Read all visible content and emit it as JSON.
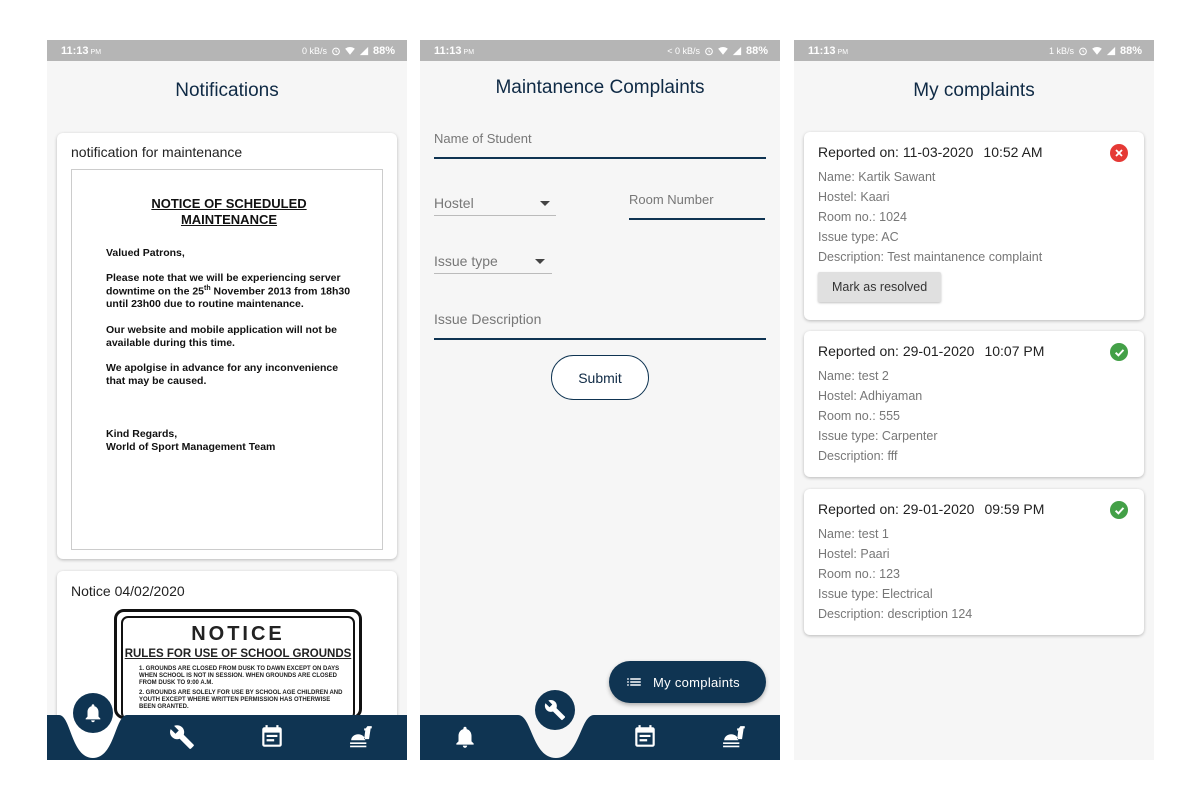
{
  "screens": [
    {
      "status": {
        "time": "11:13",
        "ampm": "PM",
        "speed": "0 kB/s",
        "battery": "88%"
      },
      "title": "Notifications",
      "cards": [
        {
          "title": "notification for maintenance",
          "doc": {
            "heading_line1": "NOTICE OF SCHEDULED",
            "heading_line2": "MAINTENANCE",
            "greeting": "Valued Patrons,",
            "para1_before": "Please note that we will be experiencing server downtime on the 25",
            "para1_sup": "th",
            "para1_after": " November 2013 from 18h30 until 23h00 due to routine maintenance.",
            "para2": "Our website and mobile application will not be available during this time.",
            "para3": "We apolgise in advance for any inconvenience that may be caused.",
            "signoff": "Kind Regards,",
            "team": "World of Sport Management Team"
          }
        },
        {
          "title": "Notice 04/02/2020",
          "sign": {
            "title": "NOTICE",
            "subtitle": "RULES FOR USE OF SCHOOL GROUNDS",
            "rule1": "1.   GROUNDS ARE CLOSED FROM DUSK TO DAWN EXCEPT ON DAYS WHEN SCHOOL IS NOT IN SESSION. WHEN GROUNDS ARE CLOSED FROM DUSK TO 9:00 A.M.",
            "rule2": "2.   GROUNDS ARE SOLELY FOR USE BY SCHOOL AGE CHILDREN AND YOUTH EXCEPT WHERE WRITTEN PERMISSION HAS OTHERWISE BEEN GRANTED."
          }
        }
      ]
    },
    {
      "status": {
        "time": "11:13",
        "ampm": "PM",
        "speed": "< 0 kB/s",
        "battery": "88%"
      },
      "title": "Maintanence Complaints",
      "form": {
        "name_placeholder": "Name of Student",
        "hostel_placeholder": "Hostel",
        "room_placeholder": "Room Number",
        "issue_type_placeholder": "Issue type",
        "description_placeholder": "Issue Description",
        "submit_label": "Submit"
      },
      "fab_label": "My complaints"
    },
    {
      "status": {
        "time": "11:13",
        "ampm": "PM",
        "speed": "1 kB/s",
        "battery": "88%"
      },
      "title": "My complaints",
      "complaints": [
        {
          "date": "Reported on: 11-03-2020",
          "time": "10:52 AM",
          "name": "Name: Kartik Sawant",
          "hostel": "Hostel: Kaari",
          "room": "Room no.: 1024",
          "issue": "Issue type: AC",
          "description": "Description: Test maintanence complaint",
          "status": "unresolved",
          "action": "Mark as resolved"
        },
        {
          "date": "Reported on: 29-01-2020",
          "time": "10:07 PM",
          "name": "Name: test 2",
          "hostel": "Hostel: Adhiyaman",
          "room": "Room no.: 555",
          "issue": "Issue type: Carpenter",
          "description": "Description: fff",
          "status": "resolved"
        },
        {
          "date": "Reported on: 29-01-2020",
          "time": "09:59 PM",
          "name": "Name: test 1",
          "hostel": "Hostel: Paari",
          "room": "Room no.: 123",
          "issue": "Issue type: Electrical",
          "description": "Description: description 124",
          "status": "resolved"
        }
      ]
    }
  ],
  "colors": {
    "primary": "#0f3452",
    "resolved": "#43a047",
    "unresolved": "#e53935",
    "background": "#f6f6f6"
  },
  "nav_icons": [
    "bell-icon",
    "wrench-icon",
    "calendar-icon",
    "food-icon"
  ]
}
